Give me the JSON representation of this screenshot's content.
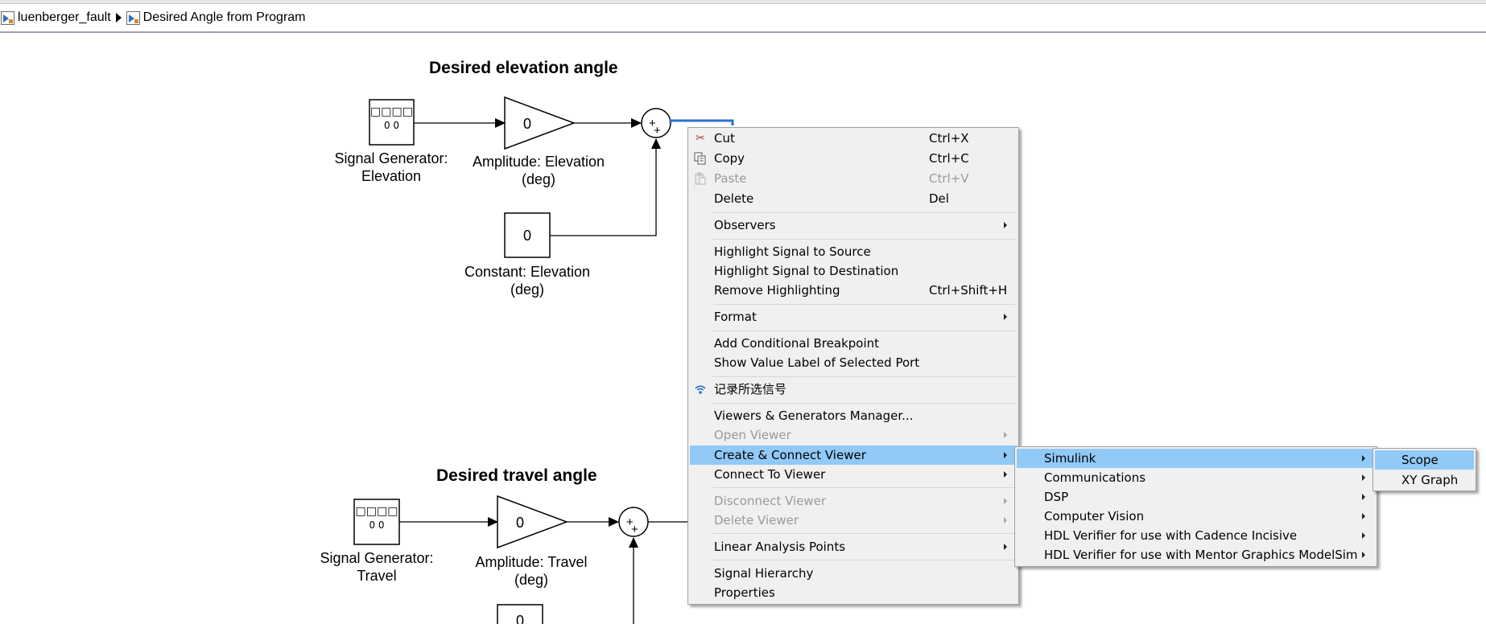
{
  "breadcrumb": {
    "items": [
      {
        "label": "luenberger_fault"
      },
      {
        "label": "Desired Angle from Program"
      }
    ]
  },
  "diagram": {
    "elevation": {
      "title": "Desired elevation angle",
      "signal_generator": {
        "label1": "Signal Generator:",
        "label2": "Elevation",
        "glyph_top": "□□□□",
        "glyph_bottom": "0 0"
      },
      "gain": {
        "value": "0",
        "label1": "Amplitude: Elevation",
        "label2": "(deg)"
      },
      "constant": {
        "value": "0",
        "label1": "Constant: Elevation",
        "label2": "(deg)"
      },
      "sum": {
        "signs": "++"
      }
    },
    "travel": {
      "title": "Desired travel angle",
      "signal_generator": {
        "label1": "Signal Generator:",
        "label2": "Travel",
        "glyph_top": "□□□□",
        "glyph_bottom": "0 0"
      },
      "gain": {
        "value": "0",
        "label1": "Amplitude: Travel",
        "label2": "(deg)"
      },
      "constant": {
        "value": "0"
      },
      "sum": {
        "signs": "++"
      }
    }
  },
  "context_menu": {
    "items": [
      {
        "label": "Cut",
        "shortcut": "Ctrl+X",
        "icon": "scissors-icon"
      },
      {
        "label": "Copy",
        "shortcut": "Ctrl+C",
        "icon": "copy-icon"
      },
      {
        "label": "Paste",
        "shortcut": "Ctrl+V",
        "icon": "paste-icon",
        "disabled": true
      },
      {
        "label": "Delete",
        "shortcut": "Del"
      },
      {
        "label": "Observers"
      },
      {
        "label": "Highlight Signal to Source"
      },
      {
        "label": "Highlight Signal to Destination"
      },
      {
        "label": "Remove Highlighting",
        "shortcut": "Ctrl+Shift+H"
      },
      {
        "label": "Format"
      },
      {
        "label": "Add Conditional Breakpoint"
      },
      {
        "label": "Show Value Label of Selected Port"
      },
      {
        "label": "记录所选信号",
        "icon": "signal-logging-icon"
      },
      {
        "label": "Viewers & Generators Manager..."
      },
      {
        "label": "Open Viewer",
        "disabled": true
      },
      {
        "label": "Create & Connect Viewer"
      },
      {
        "label": "Connect To Viewer"
      },
      {
        "label": "Disconnect Viewer",
        "disabled": true
      },
      {
        "label": "Delete Viewer",
        "disabled": true
      },
      {
        "label": "Linear Analysis Points"
      },
      {
        "label": "Signal Hierarchy"
      },
      {
        "label": "Properties"
      }
    ]
  },
  "viewer_submenu": {
    "items": [
      {
        "label": "Simulink"
      },
      {
        "label": "Communications"
      },
      {
        "label": "DSP"
      },
      {
        "label": "Computer Vision"
      },
      {
        "label": "HDL Verifier for use with Cadence Incisive"
      },
      {
        "label": "HDL Verifier for use with Mentor Graphics ModelSim"
      }
    ]
  },
  "simulink_submenu": {
    "items": [
      {
        "label": "Scope"
      },
      {
        "label": "XY Graph"
      }
    ]
  },
  "colors": {
    "menu_bg": "#f0f0f0",
    "highlight": "#91c9f7",
    "selected_signal": "#2b6fd1"
  }
}
